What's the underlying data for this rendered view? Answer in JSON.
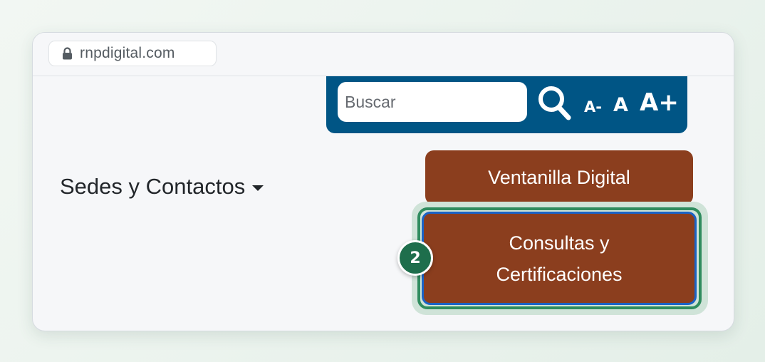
{
  "browser": {
    "url": "rnpdigital.com",
    "lock_icon": "lock-icon"
  },
  "toolbar": {
    "background_color": "#005585",
    "search_placeholder": "Buscar",
    "search_icon": "search-icon",
    "font_decrease_label": "A-",
    "font_normal_label": "A",
    "font_increase_label": "A+"
  },
  "nav": {
    "dropdown_label": "Sedes y Contactos",
    "dropdown_icon": "caret-down-icon"
  },
  "buttons": {
    "color": "#8b3e1e",
    "ventanilla_label": "Ventanilla Digital",
    "consultas_line1": "Consultas y",
    "consultas_line2": "Certificaciones"
  },
  "annotation": {
    "step_number": "2",
    "highlight_color": "#2f8c5f",
    "focus_color": "#1a63c6"
  }
}
